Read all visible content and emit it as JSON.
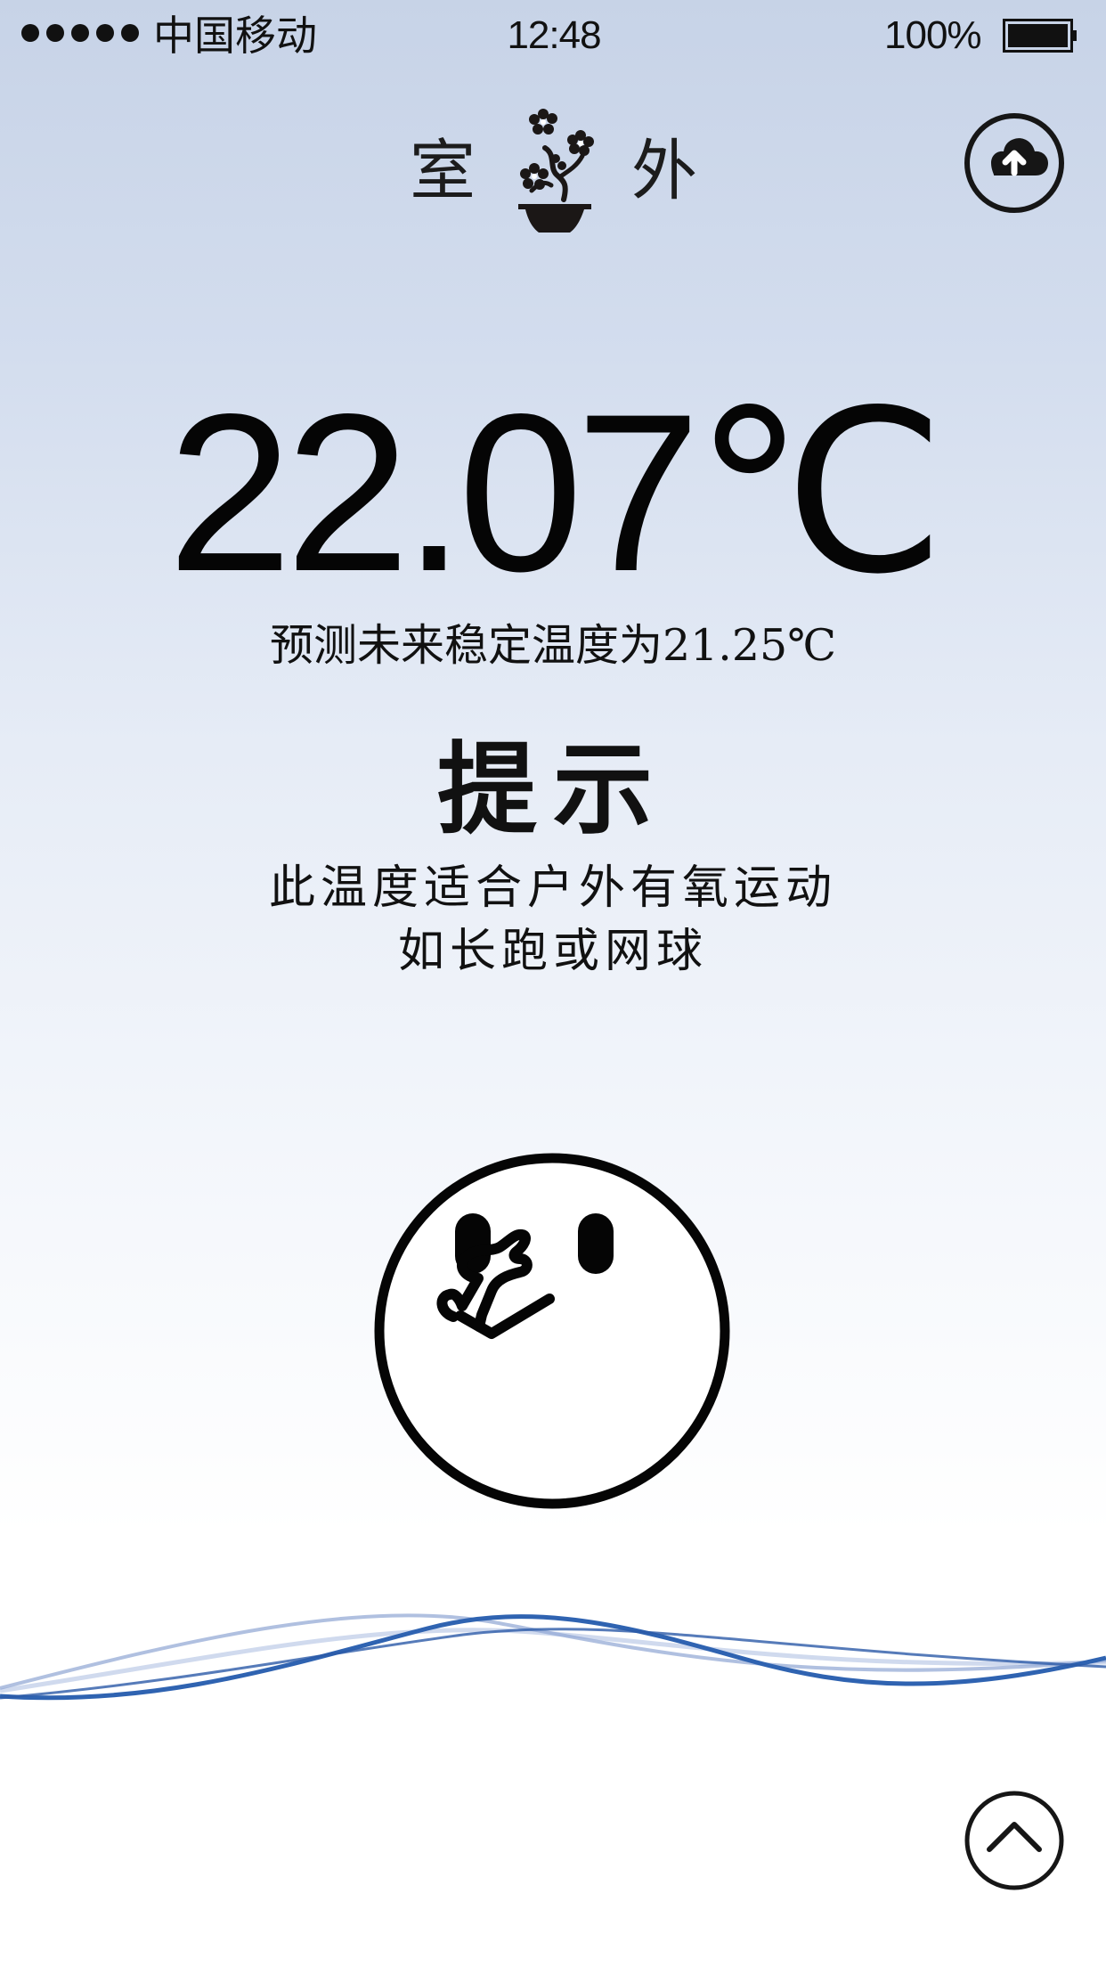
{
  "status_bar": {
    "carrier": "中国移动",
    "time": "12:48",
    "battery": "100%"
  },
  "header": {
    "left_title": "室",
    "right_title": "外"
  },
  "temperature": {
    "value": "22.07℃",
    "prediction": "预测未来稳定温度为21.25℃"
  },
  "tip": {
    "title": "提示",
    "lines": [
      "此温度适合户外有氧运动",
      "如长跑或网球"
    ]
  },
  "icons": {
    "logo": "bonsai-logo",
    "upload": "cloud-upload-icon",
    "mood": "thinking-face-icon",
    "scroll": "chevron-up-icon"
  },
  "colors": {
    "wave": "#2f63b1",
    "background_top": "#c7d3e7"
  }
}
